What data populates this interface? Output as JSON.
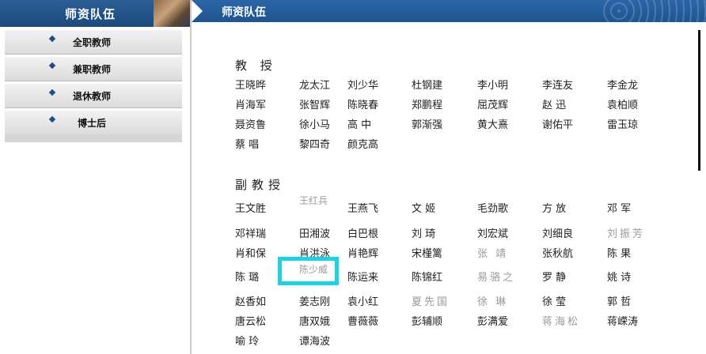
{
  "sidebar": {
    "title": "师资队伍",
    "items": [
      {
        "label": "全职教师"
      },
      {
        "label": "兼职教师"
      },
      {
        "label": "退休教师"
      },
      {
        "label": "博士后"
      }
    ]
  },
  "header": {
    "title": "师资队伍"
  },
  "colors": {
    "header_blue": "#1e5591",
    "highlight": "#19d4e4",
    "bullet": "#1a4f8a"
  },
  "sections": [
    {
      "title": "教 授",
      "names": [
        "王晓晔",
        "龙太江",
        "刘少华",
        "杜钢建",
        "李小明",
        "李连友",
        "李金龙",
        "肖海军",
        "张智辉",
        "陈晓春",
        "郑鹏程",
        "屈茂辉",
        "赵 迅",
        "袁柏顺",
        "聂资鲁",
        "徐小马",
        "高 中",
        "郭渐强",
        "黄大熹",
        "谢佑平",
        "雷玉琼",
        "蔡 唱",
        "黎四奇",
        "颜克高"
      ]
    },
    {
      "title": "副教授",
      "names": [
        "王文胜",
        "王红兵",
        "王燕飞",
        "文 姬",
        "毛劲歌",
        "方 放",
        "邓 军",
        "邓祥瑞",
        "田湘波",
        "白巴根",
        "刘 琦",
        "刘宏斌",
        "刘细良",
        "刘振芳",
        "肖和保",
        "肖洪泳",
        "肖艳辉",
        "宋槿篱",
        "张 靖",
        "张秋航",
        "陈 果",
        "陈 璐",
        "陈少威",
        "陈运来",
        "陈锦红",
        "易骆之",
        "罗 静",
        "姚 诗",
        "赵香如",
        "姜志刚",
        "袁小红",
        "夏先国",
        "徐 琳",
        "徐 莹",
        "郭 哲",
        "唐云松",
        "唐双娥",
        "曹薇薇",
        "彭辅顺",
        "彭满爱",
        "蒋海松",
        "蒋嵘涛",
        "喻 玲",
        "谭海波"
      ]
    }
  ]
}
